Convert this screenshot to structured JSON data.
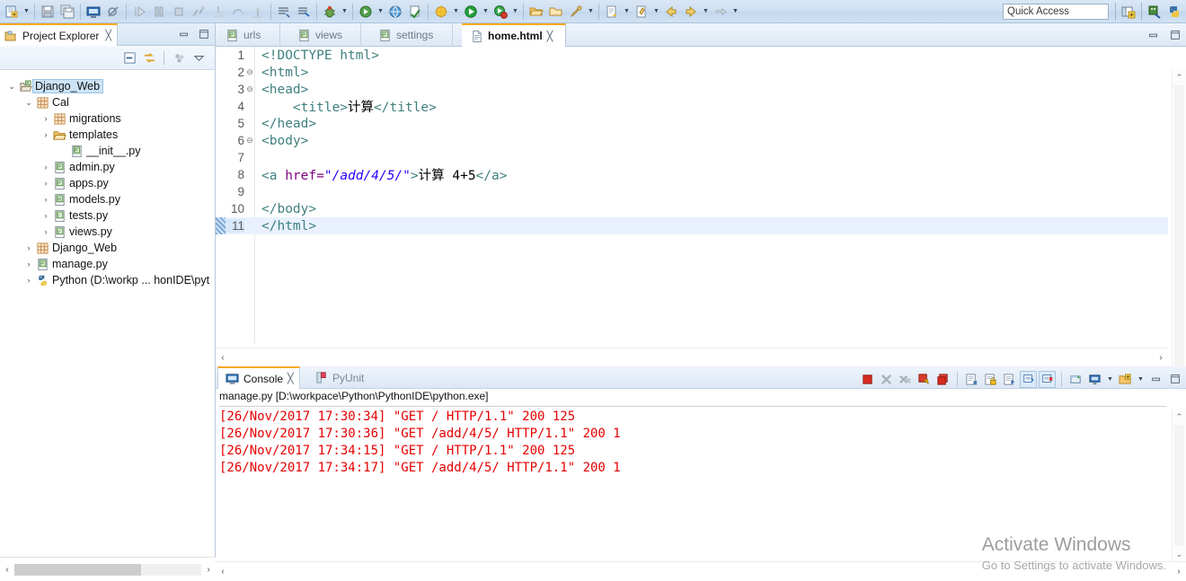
{
  "toolbar": {
    "quick_access_placeholder": "Quick Access",
    "items": [
      {
        "name": "new-wizard-icon",
        "label": "New"
      },
      {
        "name": "new-dropdown-arrow",
        "label": "New options"
      },
      {
        "name": "save-icon",
        "label": "Save"
      },
      {
        "name": "save-all-icon",
        "label": "Save All"
      },
      {
        "name": "open-console-icon",
        "label": "Open Console"
      },
      {
        "name": "skip-breakpoints-icon",
        "label": "Skip All Breakpoints"
      },
      {
        "name": "resume-icon",
        "label": "Resume"
      },
      {
        "name": "suspend-icon",
        "label": "Suspend"
      },
      {
        "name": "terminate-icon",
        "label": "Terminate"
      },
      {
        "name": "disconnect-icon",
        "label": "Disconnect"
      },
      {
        "name": "step-into-icon",
        "label": "Step Into"
      },
      {
        "name": "step-over-icon",
        "label": "Step Over"
      },
      {
        "name": "step-return-icon",
        "label": "Step Return"
      },
      {
        "name": "pin-console-icon",
        "label": "Pin Console"
      },
      {
        "name": "display-selected-console-icon",
        "label": "Display Selected Console"
      },
      {
        "name": "debug-icon",
        "label": "Debug"
      },
      {
        "name": "debug-dropdown-arrow",
        "label": "Debug configurations"
      },
      {
        "name": "run-external-tools-icon",
        "label": "External Tools"
      },
      {
        "name": "run-external-dropdown-arrow",
        "label": "External Tools options"
      },
      {
        "name": "globe-icon",
        "label": "Open Browser"
      },
      {
        "name": "validate-icon",
        "label": "Validate"
      },
      {
        "name": "new-python-project-icon",
        "label": "New Python Project"
      },
      {
        "name": "new-python-dropdown-arrow",
        "label": "New Python options"
      },
      {
        "name": "run-icon",
        "label": "Run"
      },
      {
        "name": "run-dropdown-arrow",
        "label": "Run configurations"
      },
      {
        "name": "coverage-icon",
        "label": "Coverage"
      },
      {
        "name": "coverage-dropdown-arrow",
        "label": "Coverage options"
      },
      {
        "name": "open-folder-icon",
        "label": "Open Resource"
      },
      {
        "name": "open-folder2-icon",
        "label": "Open Folder"
      },
      {
        "name": "search-pencil-icon",
        "label": "Search"
      },
      {
        "name": "search-dropdown-arrow",
        "label": "Search options"
      },
      {
        "name": "next-annotation-icon",
        "label": "Next Annotation"
      },
      {
        "name": "next-annotation-arrow",
        "label": "Next Annotation options"
      },
      {
        "name": "last-edit-icon",
        "label": "Last Edit Location"
      },
      {
        "name": "last-edit-arrow",
        "label": "Last Edit options"
      },
      {
        "name": "back-icon",
        "label": "Back"
      },
      {
        "name": "forward-icon",
        "label": "Forward"
      },
      {
        "name": "forward-arrow",
        "label": "Forward options"
      },
      {
        "name": "next-icon",
        "label": "Next"
      },
      {
        "name": "next-arrow",
        "label": "Next options"
      }
    ],
    "perspective_buttons": [
      {
        "name": "open-perspective-icon",
        "label": "Open Perspective"
      },
      {
        "name": "pydev-perspective-icon",
        "label": "PyDev"
      },
      {
        "name": "python-perspective-icon",
        "label": "Python"
      }
    ]
  },
  "project_explorer": {
    "tab_title": "Project Explorer",
    "close_glyph": "╳",
    "toolbar": [
      {
        "name": "collapse-all-icon",
        "label": "Collapse All"
      },
      {
        "name": "link-with-editor-icon",
        "label": "Link with Editor"
      },
      {
        "name": "focus-on-active-task-icon",
        "label": "Focus on Active Task"
      },
      {
        "name": "view-menu-icon",
        "label": "View Menu"
      }
    ],
    "minimize_label": "Minimize",
    "maximize_label": "Maximize",
    "tree": [
      {
        "label": "Django_Web",
        "indent": 0,
        "twist": "⌄",
        "icon": "django-project-icon",
        "selected": true
      },
      {
        "label": "Cal",
        "indent": 1,
        "twist": "⌄",
        "icon": "package-icon",
        "selected": false
      },
      {
        "label": "migrations",
        "indent": 2,
        "twist": "›",
        "icon": "package-icon",
        "selected": false
      },
      {
        "label": "templates",
        "indent": 2,
        "twist": "›",
        "icon": "folder-icon",
        "selected": false
      },
      {
        "label": "__init__.py",
        "indent": 3,
        "twist": "",
        "icon": "python-init-icon",
        "selected": false
      },
      {
        "label": "admin.py",
        "indent": 2,
        "twist": "›",
        "icon": "python-file-icon",
        "selected": false
      },
      {
        "label": "apps.py",
        "indent": 2,
        "twist": "›",
        "icon": "python-file-icon",
        "selected": false
      },
      {
        "label": "models.py",
        "indent": 2,
        "twist": "›",
        "icon": "python-model-icon",
        "selected": false
      },
      {
        "label": "tests.py",
        "indent": 2,
        "twist": "›",
        "icon": "python-test-icon",
        "selected": false
      },
      {
        "label": "views.py",
        "indent": 2,
        "twist": "›",
        "icon": "python-view-icon",
        "selected": false
      },
      {
        "label": "Django_Web",
        "indent": 1,
        "twist": "›",
        "icon": "package-icon",
        "selected": false
      },
      {
        "label": "manage.py",
        "indent": 1,
        "twist": "›",
        "icon": "python-file-icon",
        "selected": false
      },
      {
        "label": "Python  (D:\\workp ... honIDE\\pyt",
        "indent": 1,
        "twist": "›",
        "icon": "python-interpreter-icon",
        "selected": false
      }
    ],
    "hscroll": {
      "left_arrow": "‹",
      "right_arrow": "›"
    }
  },
  "editor": {
    "tabs": [
      {
        "label": "urls",
        "icon": "python-file-icon",
        "active": false,
        "close": ""
      },
      {
        "label": "views",
        "icon": "python-file-icon",
        "active": false,
        "close": ""
      },
      {
        "label": "settings",
        "icon": "python-file-icon",
        "active": false,
        "close": ""
      },
      {
        "label": "home.html",
        "icon": "html-file-icon",
        "active": true,
        "close": "╳"
      }
    ],
    "minimize_label": "Minimize",
    "maximize_label": "Maximize",
    "current_line": 11,
    "lines": [
      {
        "num": 1,
        "fold": "",
        "segments": [
          {
            "t": "<!DOCTYPE html>",
            "c": "doctype"
          }
        ]
      },
      {
        "num": 2,
        "fold": "⊖",
        "segments": [
          {
            "t": "<html>",
            "c": "tag"
          }
        ]
      },
      {
        "num": 3,
        "fold": "⊖",
        "segments": [
          {
            "t": "<head>",
            "c": "tag"
          }
        ]
      },
      {
        "num": 4,
        "fold": "",
        "segments": [
          {
            "t": "    <title>",
            "c": "tag"
          },
          {
            "t": "计算",
            "c": "plain"
          },
          {
            "t": "</title>",
            "c": "tag"
          }
        ]
      },
      {
        "num": 5,
        "fold": "",
        "segments": [
          {
            "t": "</head>",
            "c": "tag"
          }
        ]
      },
      {
        "num": 6,
        "fold": "⊖",
        "segments": [
          {
            "t": "<body>",
            "c": "tag"
          }
        ]
      },
      {
        "num": 7,
        "fold": "",
        "segments": [
          {
            "t": "",
            "c": "plain"
          }
        ]
      },
      {
        "num": 8,
        "fold": "",
        "segments": [
          {
            "t": "<a ",
            "c": "tag"
          },
          {
            "t": "href=",
            "c": "attr"
          },
          {
            "t": "\"/add/4/5/\"",
            "c": "str"
          },
          {
            "t": ">",
            "c": "tag"
          },
          {
            "t": "计算 4+5",
            "c": "plain"
          },
          {
            "t": "</a>",
            "c": "tag"
          }
        ]
      },
      {
        "num": 9,
        "fold": "",
        "segments": [
          {
            "t": "",
            "c": "plain"
          }
        ]
      },
      {
        "num": 10,
        "fold": "",
        "segments": [
          {
            "t": "</body>",
            "c": "tag"
          }
        ]
      },
      {
        "num": 11,
        "fold": "",
        "segments": [
          {
            "t": "</html>",
            "c": "tag"
          }
        ]
      }
    ],
    "hscroll": {
      "left_arrow": "‹",
      "right_arrow": "›"
    },
    "vscroll": {
      "up_arrow": "⌃",
      "down_arrow": "⌄"
    }
  },
  "console": {
    "tabs": [
      {
        "label": "Console",
        "icon": "console-icon",
        "active": true,
        "close": "╳"
      },
      {
        "label": "PyUnit",
        "icon": "pyunit-icon",
        "active": false,
        "close": ""
      }
    ],
    "toolbar": [
      {
        "name": "terminate-icon",
        "label": "Terminate"
      },
      {
        "name": "remove-launch-icon",
        "label": "Remove Launch"
      },
      {
        "name": "remove-all-terminated-icon",
        "label": "Remove All Terminated Launches"
      },
      {
        "name": "clear-console-icon",
        "label": "Clear Console"
      },
      {
        "name": "pin-console-icon",
        "label": "Pin Console"
      },
      {
        "name": "word-wrap-icon",
        "label": "Word Wrap"
      },
      {
        "name": "scroll-lock-icon",
        "label": "Scroll Lock"
      },
      {
        "name": "show-console-on-output-icon",
        "label": "Show Console When Output Changes"
      },
      {
        "name": "display-selected-console-icon",
        "label": "Display Selected Console"
      },
      {
        "name": "close-console-icon",
        "label": "Close Console"
      },
      {
        "name": "open-console-icon",
        "label": "Open Console"
      },
      {
        "name": "new-console-view-icon",
        "label": "New Console View"
      },
      {
        "name": "console-dropdown-arrow",
        "label": "Display Selected Console menu"
      },
      {
        "name": "view-menu-icon",
        "label": "View Menu"
      },
      {
        "name": "view-menu-arrow",
        "label": "View Menu options"
      }
    ],
    "minimize_label": "Minimize",
    "maximize_label": "Maximize",
    "header": "manage.py [D:\\workpace\\Python\\PythonIDE\\python.exe]",
    "output": [
      "[26/Nov/2017 17:30:34] \"GET / HTTP/1.1\" 200 125",
      "[26/Nov/2017 17:30:36] \"GET /add/4/5/ HTTP/1.1\" 200 1",
      "[26/Nov/2017 17:34:15] \"GET / HTTP/1.1\" 200 125",
      "[26/Nov/2017 17:34:17] \"GET /add/4/5/ HTTP/1.1\" 200 1"
    ],
    "text_color": "#e60000",
    "hscroll": {
      "left_arrow": "‹",
      "right_arrow": "›"
    },
    "vscroll": {
      "up_arrow": "⌃",
      "down_arrow": "⌄"
    }
  },
  "watermark": {
    "title": "Activate Windows",
    "subtitle": "Go to Settings to activate Windows."
  }
}
